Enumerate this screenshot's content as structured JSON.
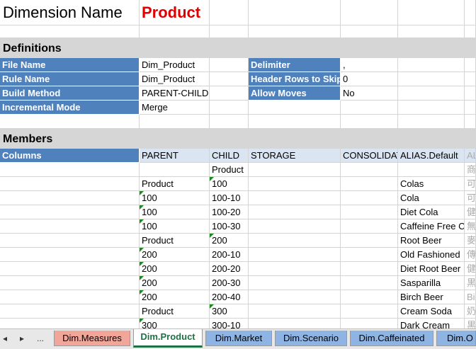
{
  "title": {
    "label": "Dimension Name",
    "value": "Product"
  },
  "definitions": {
    "heading": "Definitions",
    "left": [
      {
        "label": "File Name",
        "value": "Dim_Product"
      },
      {
        "label": "Rule Name",
        "value": "Dim_Product"
      },
      {
        "label": "Build Method",
        "value": "PARENT-CHILD"
      },
      {
        "label": "Incremental Mode",
        "value": "Merge"
      }
    ],
    "right": [
      {
        "label": "Delimiter",
        "value": ","
      },
      {
        "label": "Header Rows to Skip",
        "value": "0"
      },
      {
        "label": "Allow Moves",
        "value": "No"
      }
    ]
  },
  "members": {
    "heading": "Members",
    "columns_label": "Columns",
    "headers": [
      "PARENT",
      "CHILD",
      "STORAGE",
      "CONSOLIDAT",
      "ALIAS.Default",
      "AL"
    ],
    "rows": [
      {
        "parent": "",
        "child": "Product",
        "alias": "",
        "alias2": "商"
      },
      {
        "parent": "Product",
        "child": "100",
        "alias": "Colas",
        "alias2": "可"
      },
      {
        "parent": "100",
        "child": "100-10",
        "alias": "Cola",
        "alias2": "可"
      },
      {
        "parent": "100",
        "child": "100-20",
        "alias": "Diet Cola",
        "alias2": "健"
      },
      {
        "parent": "100",
        "child": "100-30",
        "alias": "Caffeine Free C",
        "alias2": "無"
      },
      {
        "parent": "Product",
        "child": "200",
        "alias": "Root Beer",
        "alias2": "麥"
      },
      {
        "parent": "200",
        "child": "200-10",
        "alias": "Old Fashioned",
        "alias2": "傳"
      },
      {
        "parent": "200",
        "child": "200-20",
        "alias": "Diet Root Beer",
        "alias2": "健"
      },
      {
        "parent": "200",
        "child": "200-30",
        "alias": "Sasparilla",
        "alias2": "黒"
      },
      {
        "parent": "200",
        "child": "200-40",
        "alias": "Birch Beer",
        "alias2": "Bi"
      },
      {
        "parent": "Product",
        "child": "300",
        "alias": "Cream Soda",
        "alias2": "奶"
      },
      {
        "parent": "300",
        "child": "300-10",
        "alias": "Dark Cream",
        "alias2": "黒"
      }
    ]
  },
  "tabs": {
    "nav_prev": "◂",
    "nav_next": "▸",
    "nav_more": "...",
    "items": [
      "Dim.Measures",
      "Dim.Product",
      "Dim.Market",
      "Dim.Scenario",
      "Dim.Caffeinated",
      "Dim.O"
    ]
  },
  "colors": {
    "header_blue": "#4f81bd",
    "title_red": "#e00000",
    "active_tab_green": "#1e7145",
    "measures_tab": "#f2a69a",
    "other_tab": "#8eb4e3"
  }
}
